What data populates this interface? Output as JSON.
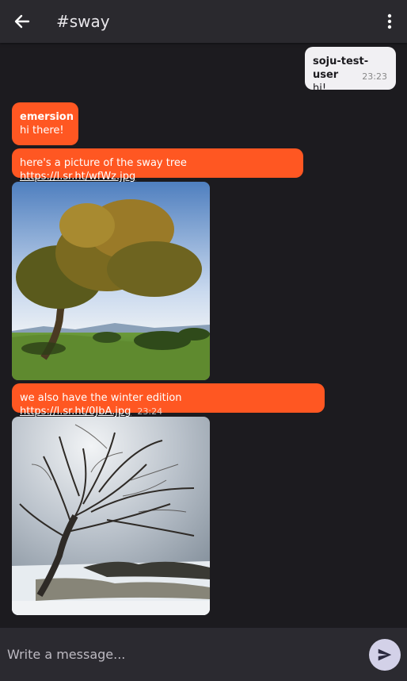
{
  "header": {
    "title": "#sway",
    "back_icon": "arrow-left-icon",
    "menu_icon": "more-vertical-icon"
  },
  "messages": [
    {
      "sender": "soju-test-user",
      "text": "hi!",
      "time": "23:23"
    },
    {
      "sender": "emersion",
      "text": "hi there!"
    },
    {
      "text": "here's a picture of the sway tree ",
      "link": "https://l.sr.ht/wfWz.jpg"
    },
    {
      "text": "we also have the winter edition ",
      "link": "https://l.sr.ht/0JbA.jpg",
      "time": "23:24"
    }
  ],
  "composer": {
    "placeholder": "Write a message...",
    "send_icon": "send-icon"
  },
  "colors": {
    "accent": "#ff5722",
    "background": "#1c1b1f",
    "topbar": "#2a292e"
  }
}
